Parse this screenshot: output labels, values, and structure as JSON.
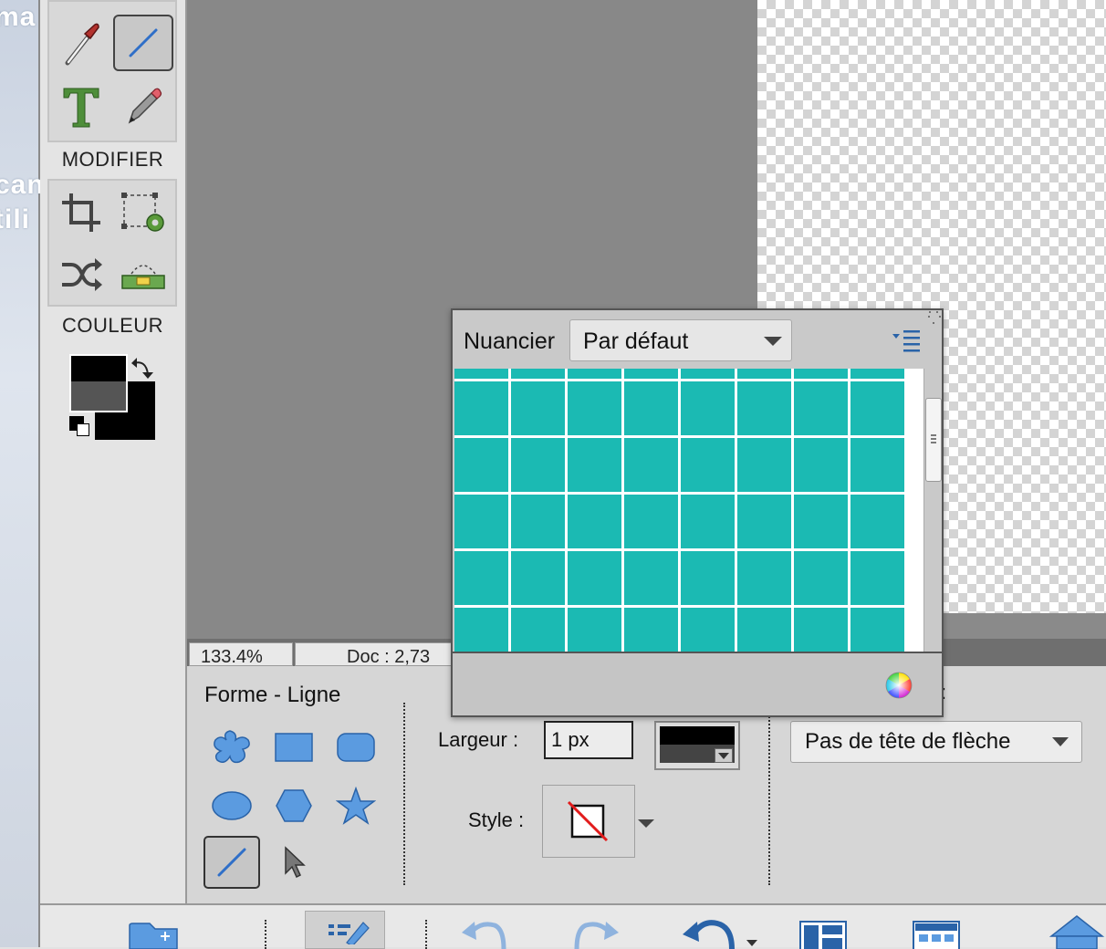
{
  "desktop": {
    "text_fragments": [
      "ma",
      "can",
      "tili"
    ]
  },
  "tools_panel": {
    "section_modify": "MODIFIER",
    "section_color": "COULEUR"
  },
  "status": {
    "zoom": "133.4%",
    "doc": "Doc : 2,73"
  },
  "options": {
    "shape_title": "Forme - Ligne",
    "width_label": "Largeur :",
    "width_value": "1 px",
    "style_label": "Style :",
    "colon_fragment": ":",
    "arrow_select": "Pas de tête de flèche"
  },
  "swatches_panel": {
    "title": "Nuancier",
    "preset": "Par défaut",
    "swatch_color": "#1bbab3",
    "columns": 8,
    "rows": 5
  },
  "colors": {
    "foreground": "#000000",
    "background": "#000000",
    "swatch": "#1bbab3",
    "pasteboard": "#888888"
  }
}
